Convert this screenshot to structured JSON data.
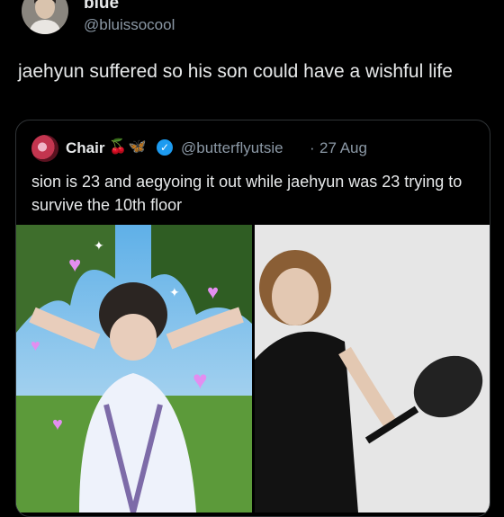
{
  "tweet": {
    "author_name": "blue",
    "author_handle": "@bluissocool",
    "text": "jaehyun suffered so his son could have a wishful life"
  },
  "quote": {
    "name": "Chair",
    "name_emojis": [
      "cherries",
      "butterfly"
    ],
    "verified_icon": "verified-badge",
    "handle": "@butterflyutsie",
    "separator": "·",
    "date": "27 Aug",
    "text": "sion is 23 and aegyoing it out while jaehyun was 23 trying to survive the 10th floor"
  },
  "colors": {
    "background": "#000000",
    "text": "#e7e9ea",
    "secondary_text": "#8b98a5",
    "border": "#2f3336",
    "verified": "#1d9bf0"
  }
}
